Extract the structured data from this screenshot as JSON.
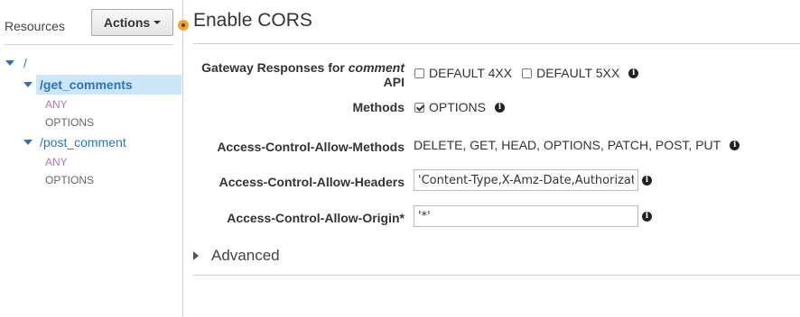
{
  "sidebar": {
    "title": "Resources",
    "actions_label": "Actions",
    "tree": [
      {
        "path": "/"
      },
      {
        "path": "/get_comments",
        "methods": [
          "ANY",
          "OPTIONS"
        ]
      },
      {
        "path": "/post_comment",
        "methods": [
          "ANY",
          "OPTIONS"
        ]
      }
    ]
  },
  "main": {
    "title": "Enable CORS",
    "gateway_label_prefix": "Gateway Responses for ",
    "gateway_label_em": "comment",
    "gateway_label_suffix": "API",
    "default_4xx_label": "DEFAULT 4XX",
    "default_5xx_label": "DEFAULT 5XX",
    "methods_label": "Methods",
    "options_label": "OPTIONS",
    "allow_methods_label": "Access-Control-Allow-Methods",
    "allow_methods_value": "DELETE, GET, HEAD, OPTIONS, PATCH, POST, PUT",
    "allow_headers_label": "Access-Control-Allow-Headers",
    "allow_headers_value": "'Content-Type,X-Amz-Date,Authorizat",
    "allow_origin_label": "Access-Control-Allow-Origin*",
    "allow_origin_value": "'*'",
    "advanced_label": "Advanced"
  },
  "icons": {
    "info": "info-icon",
    "actions_caret": "caret-down-icon",
    "tree_expand": "triangle-down-icon",
    "advanced_expand": "triangle-right-icon",
    "connector": "resize-handle-icon"
  },
  "colors": {
    "link": "#2e73b8",
    "selected_bg": "#cde6f7",
    "any_method": "#c36ac8",
    "options_method": "#666666",
    "connector": "#f0a62a"
  }
}
